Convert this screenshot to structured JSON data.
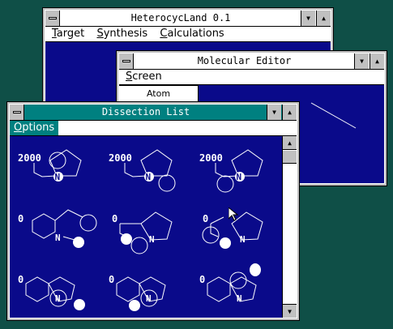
{
  "main_window": {
    "title": "HeterocycLand  0.1",
    "menu": [
      {
        "u": "T",
        "rest": "arget"
      },
      {
        "u": "S",
        "rest": "ynthesis"
      },
      {
        "u": "C",
        "rest": "alculations"
      }
    ]
  },
  "editor_window": {
    "title": "Molecular Editor",
    "menu": [
      {
        "u": "S",
        "rest": "creen"
      }
    ],
    "tab_label": "Atom"
  },
  "dissection_window": {
    "title": "Dissection List",
    "menu": [
      {
        "u": "O",
        "rest": "ptions"
      }
    ],
    "items": [
      {
        "label": "2000",
        "atom": "N"
      },
      {
        "label": "2000",
        "atom": "N"
      },
      {
        "label": "2000",
        "atom": "N"
      },
      {
        "label": "0",
        "atom": "N"
      },
      {
        "label": "0",
        "atom": "N"
      },
      {
        "label": "0",
        "atom": "N"
      },
      {
        "label": "0",
        "atom": "N"
      },
      {
        "label": "0",
        "atom": "N"
      },
      {
        "label": "0",
        "atom": "N"
      }
    ]
  },
  "icons": {
    "system": "system-menu-icon",
    "minimize": "minimize-arrow-icon",
    "maximize": "maximize-arrow-icon",
    "scroll_up": "scroll-up-arrow-icon",
    "scroll_down": "scroll-down-arrow-icon",
    "cursor": "mouse-pointer-icon"
  },
  "colors": {
    "desktop": "#0f4f47",
    "client": "#0a0a8a",
    "active_title": "#008080",
    "drawing": "#ffffff"
  }
}
